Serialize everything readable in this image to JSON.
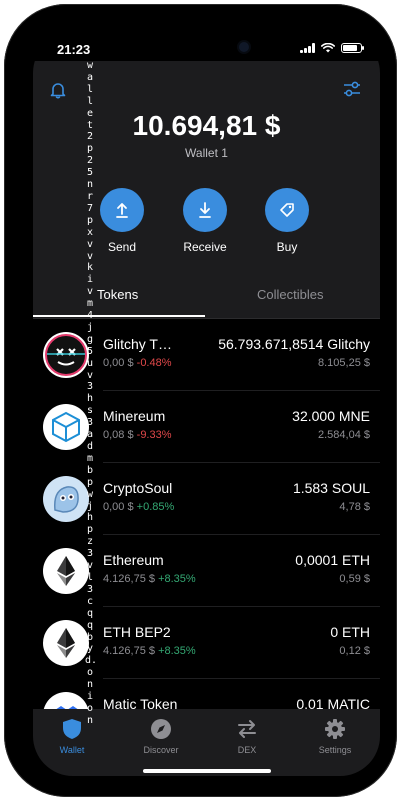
{
  "status_bar": {
    "time": "21:23"
  },
  "header": {
    "balance": "10.694,81 $",
    "wallet_name": "Wallet 1",
    "icons": [
      "bell-icon",
      "filter-sliders-icon"
    ]
  },
  "actions": [
    {
      "label": "Send",
      "icon": "arrow-up-icon"
    },
    {
      "label": "Receive",
      "icon": "arrow-down-icon"
    },
    {
      "label": "Buy",
      "icon": "tag-icon"
    }
  ],
  "tabs": [
    {
      "label": "Tokens",
      "active": true
    },
    {
      "label": "Collectibles",
      "active": false
    }
  ],
  "tokens": [
    {
      "name": "Glitchy T…",
      "price": "0,00 $",
      "change": "-0.48%",
      "trend": "down",
      "balance": "56.793.671,8514 Glitchy",
      "fiat": "8.105,25 $",
      "icon": "glitchy-face-icon"
    },
    {
      "name": "Minereum",
      "price": "0,08 $",
      "change": "-9.33%",
      "trend": "down",
      "balance": "32.000 MNE",
      "fiat": "2.584,04 $",
      "icon": "cube-icon"
    },
    {
      "name": "CryptoSoul",
      "price": "0,00 $",
      "change": "+0.85%",
      "trend": "up",
      "balance": "1.583 SOUL",
      "fiat": "4,78 $",
      "icon": "soul-ghost-icon"
    },
    {
      "name": "Ethereum",
      "price": "4.126,75 $",
      "change": "+8.35%",
      "trend": "up",
      "balance": "0,0001 ETH",
      "fiat": "0,59 $",
      "icon": "ethereum-icon"
    },
    {
      "name": "ETH BEP2",
      "price": "4.126,75 $",
      "change": "+8.35%",
      "trend": "up",
      "balance": "0 ETH",
      "fiat": "0,12 $",
      "icon": "ethereum-icon"
    },
    {
      "name": "Matic Token",
      "price": "",
      "change": "",
      "trend": "up",
      "balance": "0,01 MATIC",
      "fiat": "",
      "icon": "matic-icon"
    }
  ],
  "bottom_nav": [
    {
      "label": "Wallet",
      "icon": "shield-icon",
      "active": true
    },
    {
      "label": "Discover",
      "icon": "compass-icon",
      "active": false
    },
    {
      "label": "DEX",
      "icon": "swap-arrows-icon",
      "active": false
    },
    {
      "label": "Settings",
      "icon": "gear-icon",
      "active": false
    }
  ],
  "overlay_text": "wallet2p25nr7pxvvkivm4jg5uv3hs3admbpwjhpz3vl3cqqbyd.onion",
  "colors": {
    "accent": "#3a8dde",
    "positive": "#34a873",
    "negative": "#e0484a",
    "panel": "#1c1c1e",
    "background": "#000000"
  }
}
